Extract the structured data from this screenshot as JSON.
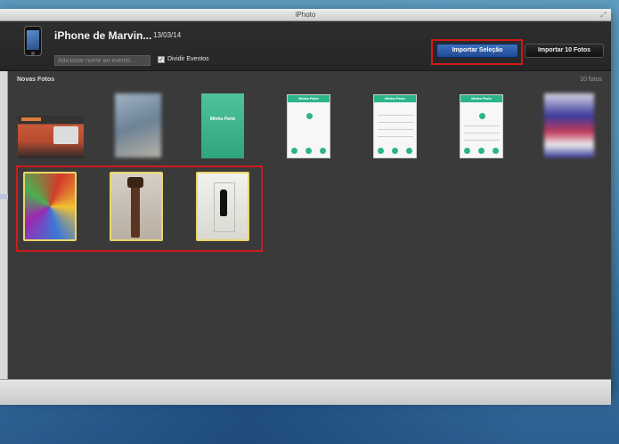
{
  "window": {
    "title": "iPhoto"
  },
  "header": {
    "device_name": "iPhone de Marvin...",
    "date": "13/03/14",
    "event_name_placeholder": "Adicionar nome ao evento...",
    "split_events_label": "Dividir Eventos",
    "split_events_checked": true,
    "import_selection_label": "Importar Seleção",
    "import_all_label": "Importar 10 Fotos"
  },
  "content": {
    "section_title": "Novas Fotos",
    "photo_count": "10 fotos",
    "app_title": "Minha Parte"
  },
  "colors": {
    "accent_blue": "#1e4a93",
    "selection_border": "#e9d66b",
    "annotation_red": "#d11a1a",
    "app_green": "#2cb58a"
  }
}
